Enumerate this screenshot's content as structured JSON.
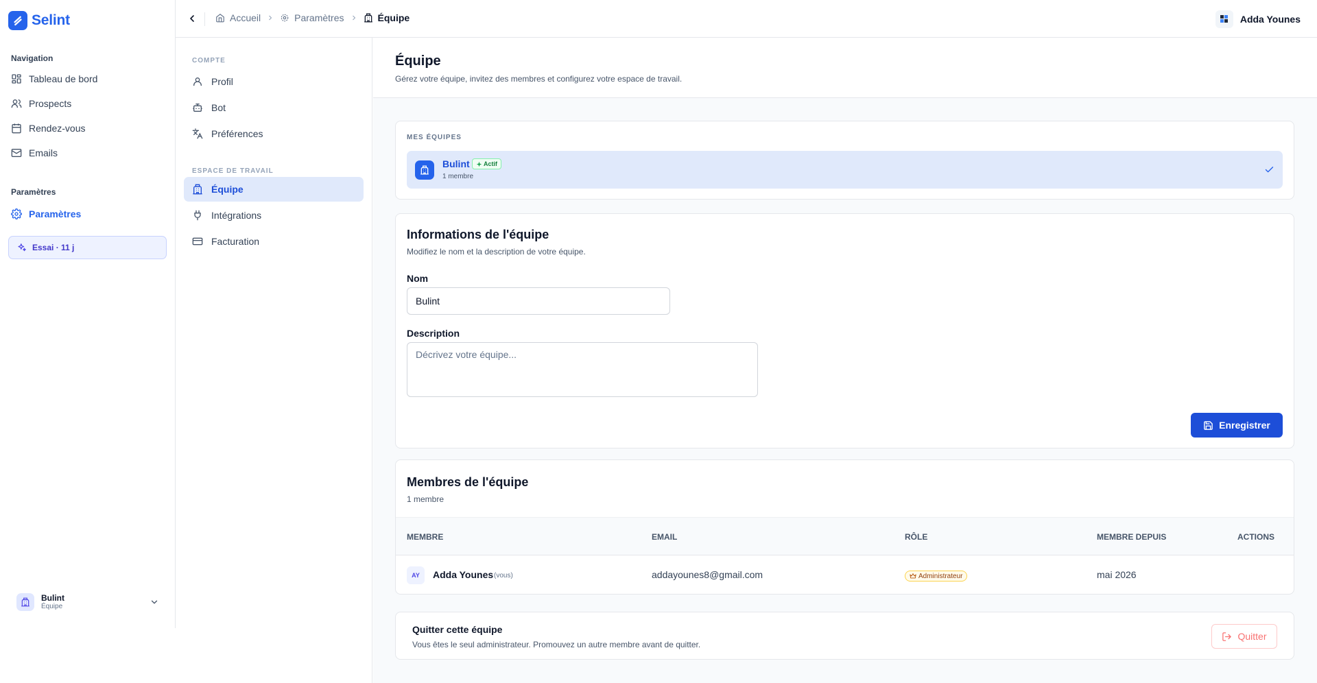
{
  "app": {
    "name": "Selint",
    "accent": "#2563eb"
  },
  "sidebar": {
    "nav_label": "Navigation",
    "items": [
      {
        "label": "Tableau de bord",
        "icon": "dashboard-icon"
      },
      {
        "label": "Prospects",
        "icon": "users-icon"
      },
      {
        "label": "Rendez-vous",
        "icon": "calendar-icon"
      },
      {
        "label": "Emails",
        "icon": "mail-icon"
      }
    ],
    "settings_label": "Paramètres",
    "settings_item": {
      "label": "Paramètres",
      "icon": "gear-icon"
    },
    "trial": "Essai · 11 j",
    "team": {
      "name": "Bulint",
      "subtitle": "Équipe"
    }
  },
  "topbar": {
    "breadcrumb": [
      {
        "label": "Accueil",
        "icon": "home-icon"
      },
      {
        "label": "Paramètres",
        "icon": "gear-icon"
      },
      {
        "label": "Équipe",
        "icon": "building-icon"
      }
    ],
    "user": "Adda Younes"
  },
  "settings_nav": {
    "account_label": "COMPTE",
    "account_items": [
      {
        "label": "Profil",
        "icon": "user-icon"
      },
      {
        "label": "Bot",
        "icon": "bot-icon"
      },
      {
        "label": "Préférences",
        "icon": "translate-icon"
      }
    ],
    "workspace_label": "ESPACE DE TRAVAIL",
    "workspace_items": [
      {
        "label": "Équipe",
        "icon": "building-icon",
        "active": true
      },
      {
        "label": "Intégrations",
        "icon": "plug-icon"
      },
      {
        "label": "Facturation",
        "icon": "credit-card-icon"
      }
    ]
  },
  "page": {
    "title": "Équipe",
    "subtitle": "Gérez votre équipe, invitez des membres et configurez votre espace de travail."
  },
  "my_teams": {
    "label": "MES ÉQUIPES",
    "team": {
      "name": "Bulint",
      "badge": "Actif",
      "members": "1 membre"
    }
  },
  "team_info": {
    "title": "Informations de l'équipe",
    "subtitle": "Modifiez le nom et la description de votre équipe.",
    "name_label": "Nom",
    "name_value": "Bulint",
    "description_label": "Description",
    "description_placeholder": "Décrivez votre équipe...",
    "save_label": "Enregistrer"
  },
  "members": {
    "title": "Membres de l'équipe",
    "count": "1 membre",
    "columns": [
      "Membre",
      "Email",
      "Rôle",
      "Membre depuis",
      "Actions"
    ],
    "rows": [
      {
        "initials": "AY",
        "name": "Adda Younes",
        "you": "(vous)",
        "email": "addayounes8@gmail.com",
        "role": "Administrateur",
        "since": "mai 2026"
      }
    ]
  },
  "leave": {
    "title": "Quitter cette équipe",
    "subtitle": "Vous êtes le seul administrateur. Promouvez un autre membre avant de quitter.",
    "button": "Quitter"
  }
}
